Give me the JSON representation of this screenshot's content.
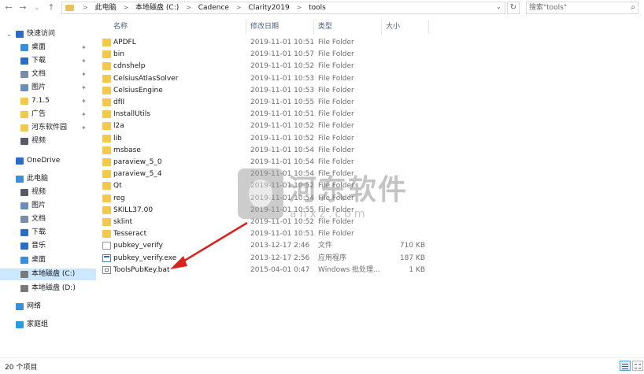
{
  "address": {
    "crumbs": [
      "此电脑",
      "本地磁盘 (C:)",
      "Cadence",
      "Clarity2019",
      "tools"
    ],
    "separator": ">"
  },
  "search": {
    "placeholder": "搜索\"tools\""
  },
  "nav": {
    "back_icon": "arrow-left-icon",
    "forward_icon": "arrow-right-icon",
    "recent_icon": "chevron-down-icon",
    "up_icon": "arrow-up-icon",
    "refresh_icon": "refresh-icon"
  },
  "sidebar": {
    "items": [
      {
        "label": "快速访问",
        "icon": "star-icon",
        "level": 0,
        "expand": "⌄"
      },
      {
        "label": "桌面",
        "icon": "desktop-icon",
        "level": 1,
        "pinned": true
      },
      {
        "label": "下载",
        "icon": "download-icon",
        "level": 1,
        "pinned": true
      },
      {
        "label": "文档",
        "icon": "documents-icon",
        "level": 1,
        "pinned": true
      },
      {
        "label": "图片",
        "icon": "pictures-icon",
        "level": 1,
        "pinned": true
      },
      {
        "label": "7.1.5",
        "icon": "folder-icon",
        "level": 1,
        "pinned": true
      },
      {
        "label": "广告",
        "icon": "folder-icon",
        "level": 1,
        "pinned": true
      },
      {
        "label": "河东软件园",
        "icon": "folder-icon",
        "level": 1,
        "pinned": true
      },
      {
        "label": "视频",
        "icon": "videos-icon",
        "level": 1
      },
      {
        "label": "OneDrive",
        "icon": "onedrive-icon",
        "level": 0
      },
      {
        "label": "此电脑",
        "icon": "computer-icon",
        "level": 0
      },
      {
        "label": "视频",
        "icon": "videos-icon",
        "level": 1
      },
      {
        "label": "图片",
        "icon": "pictures-icon",
        "level": 1
      },
      {
        "label": "文档",
        "icon": "documents-icon",
        "level": 1
      },
      {
        "label": "下载",
        "icon": "download-icon",
        "level": 1
      },
      {
        "label": "音乐",
        "icon": "music-icon",
        "level": 1
      },
      {
        "label": "桌面",
        "icon": "desktop-icon",
        "level": 1
      },
      {
        "label": "本地磁盘 (C:)",
        "icon": "drive-icon",
        "level": 1,
        "selected": true
      },
      {
        "label": "本地磁盘 (D:)",
        "icon": "drive-icon",
        "level": 1
      },
      {
        "label": "网络",
        "icon": "network-icon",
        "level": 0
      },
      {
        "label": "家庭组",
        "icon": "homegroup-icon",
        "level": 0
      }
    ]
  },
  "columns": {
    "name": "名称",
    "date": "修改日期",
    "type": "类型",
    "size": "大小"
  },
  "files": [
    {
      "name": "APDFL",
      "date": "2019-11-01 10:51",
      "type": "File Folder",
      "size": "",
      "kind": "folder"
    },
    {
      "name": "bin",
      "date": "2019-11-01 10:57",
      "type": "File Folder",
      "size": "",
      "kind": "folder"
    },
    {
      "name": "cdnshelp",
      "date": "2019-11-01 10:52",
      "type": "File Folder",
      "size": "",
      "kind": "folder"
    },
    {
      "name": "CelsiusAtlasSolver",
      "date": "2019-11-01 10:53",
      "type": "File Folder",
      "size": "",
      "kind": "folder"
    },
    {
      "name": "CelsiusEngine",
      "date": "2019-11-01 10:53",
      "type": "File Folder",
      "size": "",
      "kind": "folder"
    },
    {
      "name": "dfII",
      "date": "2019-11-01 10:55",
      "type": "File Folder",
      "size": "",
      "kind": "folder"
    },
    {
      "name": "InstallUtils",
      "date": "2019-11-01 10:51",
      "type": "File Folder",
      "size": "",
      "kind": "folder"
    },
    {
      "name": "l2a",
      "date": "2019-11-01 10:52",
      "type": "File Folder",
      "size": "",
      "kind": "folder"
    },
    {
      "name": "lib",
      "date": "2019-11-01 10:52",
      "type": "File Folder",
      "size": "",
      "kind": "folder"
    },
    {
      "name": "msbase",
      "date": "2019-11-01 10:54",
      "type": "File Folder",
      "size": "",
      "kind": "folder"
    },
    {
      "name": "paraview_5_0",
      "date": "2019-11-01 10:54",
      "type": "File Folder",
      "size": "",
      "kind": "folder"
    },
    {
      "name": "paraview_5_4",
      "date": "2019-11-01 10:54",
      "type": "File Folder",
      "size": "",
      "kind": "folder"
    },
    {
      "name": "Qt",
      "date": "2019-11-01 10:52",
      "type": "File Folder",
      "size": "",
      "kind": "folder"
    },
    {
      "name": "reg",
      "date": "2019-11-01 10:54",
      "type": "File Folder",
      "size": "",
      "kind": "folder"
    },
    {
      "name": "SKILL37.00",
      "date": "2019-11-01 10:55",
      "type": "File Folder",
      "size": "",
      "kind": "folder"
    },
    {
      "name": "sklint",
      "date": "2019-11-01 10:52",
      "type": "File Folder",
      "size": "",
      "kind": "folder"
    },
    {
      "name": "Tesseract",
      "date": "2019-11-01 10:51",
      "type": "File Folder",
      "size": "",
      "kind": "folder"
    },
    {
      "name": "pubkey_verify",
      "date": "2013-12-17 2:46",
      "type": "文件",
      "size": "710 KB",
      "kind": "file"
    },
    {
      "name": "pubkey_verify.exe",
      "date": "2013-12-17 2:56",
      "type": "应用程序",
      "size": "187 KB",
      "kind": "exe"
    },
    {
      "name": "ToolsPubKey.bat",
      "date": "2015-04-01 0:47",
      "type": "Windows 批处理...",
      "size": "1 KB",
      "kind": "bat"
    }
  ],
  "status": {
    "count": "20 个项目"
  },
  "watermark": {
    "text": "河东软件",
    "sub": "anxz.com"
  },
  "colors": {
    "selection": "#cce8ff",
    "folder": "#f0c94d",
    "header_text": "#4c607a",
    "arrow": "#d9231f"
  }
}
